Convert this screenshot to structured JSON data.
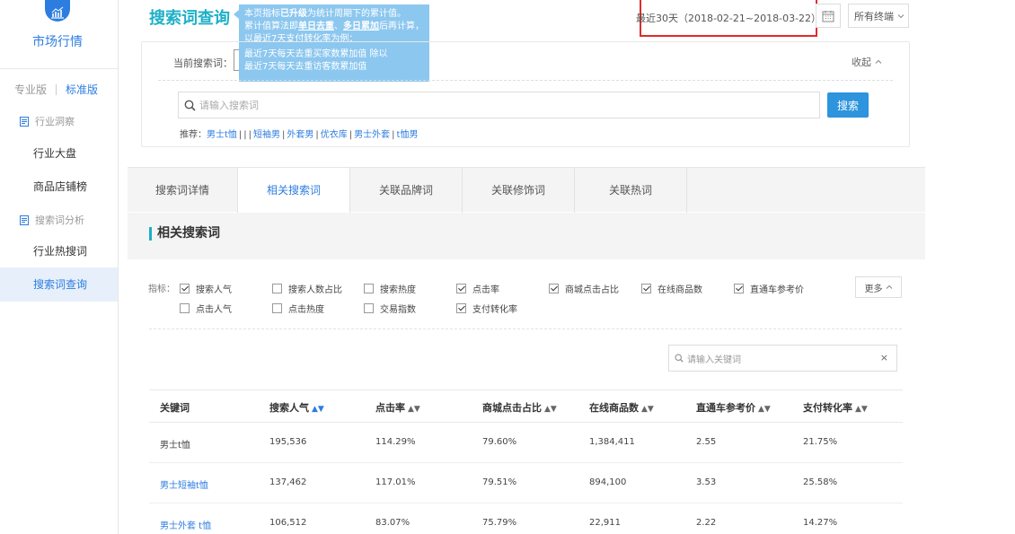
{
  "sidebar": {
    "title": "市场行情",
    "edition_pro": "专业版",
    "edition_std": "标准版",
    "group1": "行业洞察",
    "group1_items": [
      "行业大盘",
      "商品店铺榜"
    ],
    "group2": "搜索词分析",
    "group2_items": [
      "行业热搜词",
      "搜索词查询"
    ]
  },
  "header": {
    "title": "搜索词查询",
    "tooltip": {
      "line1_pre": "本页指标",
      "line1_bold": "已升级",
      "line1_post": "为统计周期下的累计值。",
      "line2_pre": "累计值算法即",
      "line2_bold1": "单日去重",
      "line2_mid": "、",
      "line2_bold2": "多日累加",
      "line2_post": "后再计算，",
      "line3": "以最近7天支付转化率为例：",
      "line4": "最近7天每天去重买家数累加值 除以",
      "line5": "最近7天每天去重访客数累加值"
    },
    "date_range": "最近30天（2018-02-21~2018-03-22）",
    "terminal": "所有终端"
  },
  "search": {
    "current_label": "当前搜索词：",
    "collapse": "收起",
    "placeholder": "请输入搜索词",
    "button": "搜索",
    "recommend_label": "推荐：",
    "recommend_items": [
      "男士t恤",
      "|",
      "短袖男",
      "外套男",
      "优衣库",
      "男士外套",
      "t恤男"
    ]
  },
  "tabs": [
    "搜索词详情",
    "相关搜索词",
    "关联品牌词",
    "关联修饰词",
    "关联热词"
  ],
  "active_tab": "相关搜索词",
  "section_title": "相关搜索词",
  "indicators": {
    "label": "指标：",
    "items": [
      {
        "label": "搜索人气",
        "checked": true
      },
      {
        "label": "搜索人数占比",
        "checked": false
      },
      {
        "label": "搜索热度",
        "checked": false
      },
      {
        "label": "点击率",
        "checked": true
      },
      {
        "label": "商城点击占比",
        "checked": true
      },
      {
        "label": "在线商品数",
        "checked": true
      },
      {
        "label": "直通车参考价",
        "checked": true
      },
      {
        "label": "点击人气",
        "checked": false
      },
      {
        "label": "点击热度",
        "checked": false
      },
      {
        "label": "交易指数",
        "checked": false
      },
      {
        "label": "支付转化率",
        "checked": true
      }
    ],
    "more": "更多"
  },
  "keyword_filter": {
    "placeholder": "请输入关键词",
    "clear": "×"
  },
  "table": {
    "headers": [
      "关键词",
      "搜索人气",
      "点击率",
      "商城点击占比",
      "在线商品数",
      "直通车参考价",
      "支付转化率"
    ],
    "rows": [
      [
        "男士t恤",
        "195,536",
        "114.29%",
        "79.60%",
        "1,384,411",
        "2.55",
        "21.75%"
      ],
      [
        "男士短袖t恤",
        "137,462",
        "117.01%",
        "79.51%",
        "894,100",
        "3.53",
        "25.58%"
      ],
      [
        "男士外套 t恤",
        "106,512",
        "83.07%",
        "75.79%",
        "22,911",
        "2.22",
        "14.27%"
      ]
    ]
  }
}
